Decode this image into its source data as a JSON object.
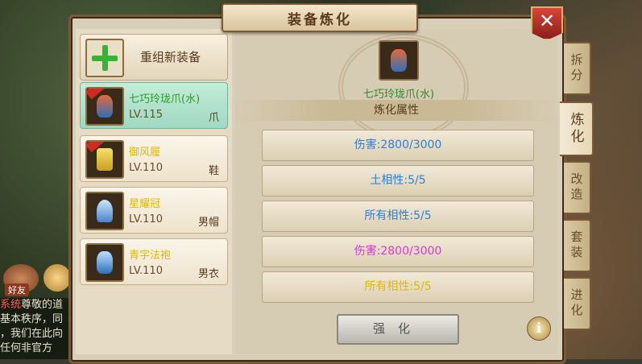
{
  "window": {
    "title": "装备炼化",
    "close_label": "✕"
  },
  "chat": {
    "friend_label": "好友",
    "lines": [
      {
        "tag": "系统",
        "text": "尊敬的道"
      },
      {
        "text": "基本秩序，同"
      },
      {
        "text": "，我们在此向"
      },
      {
        "text": "任何非官方"
      }
    ]
  },
  "left_panel": {
    "add_label": "重组新装备",
    "items": [
      {
        "name": "七巧玲珑爪(水)",
        "level": "LV.115",
        "type": "爪",
        "selected": true,
        "name_color": "#2d9a2d"
      },
      {
        "name": "御风履",
        "level": "LV.110",
        "type": "鞋",
        "selected": false,
        "name_color": "#e0b800"
      },
      {
        "name": "星耀冠",
        "level": "LV.110",
        "type": "男帽",
        "selected": false,
        "name_color": "#e0b800"
      },
      {
        "name": "青宇法袍",
        "level": "LV.110",
        "type": "男衣",
        "selected": false,
        "name_color": "#e0b800"
      }
    ]
  },
  "detail": {
    "item_name": "七巧玲珑爪(水)",
    "section_title": "炼化属性",
    "attributes": [
      {
        "text": "伤害:2800/3000",
        "color": "#2e7fd8"
      },
      {
        "text": "土相性:5/5",
        "color": "#2e7fd8"
      },
      {
        "text": "所有相性:5/5",
        "color": "#2e7fd8"
      },
      {
        "text": "伤害:2800/3000",
        "color": "#d63ad6"
      },
      {
        "text": "所有相性:5/5",
        "color": "#e0b800"
      }
    ],
    "strengthen_label": "强化",
    "info_label": "i"
  },
  "tabs": [
    {
      "label": "拆分",
      "active": false
    },
    {
      "label": "炼化",
      "active": true
    },
    {
      "label": "改造",
      "active": false
    },
    {
      "label": "套装",
      "active": false
    },
    {
      "label": "进化",
      "active": false
    }
  ]
}
